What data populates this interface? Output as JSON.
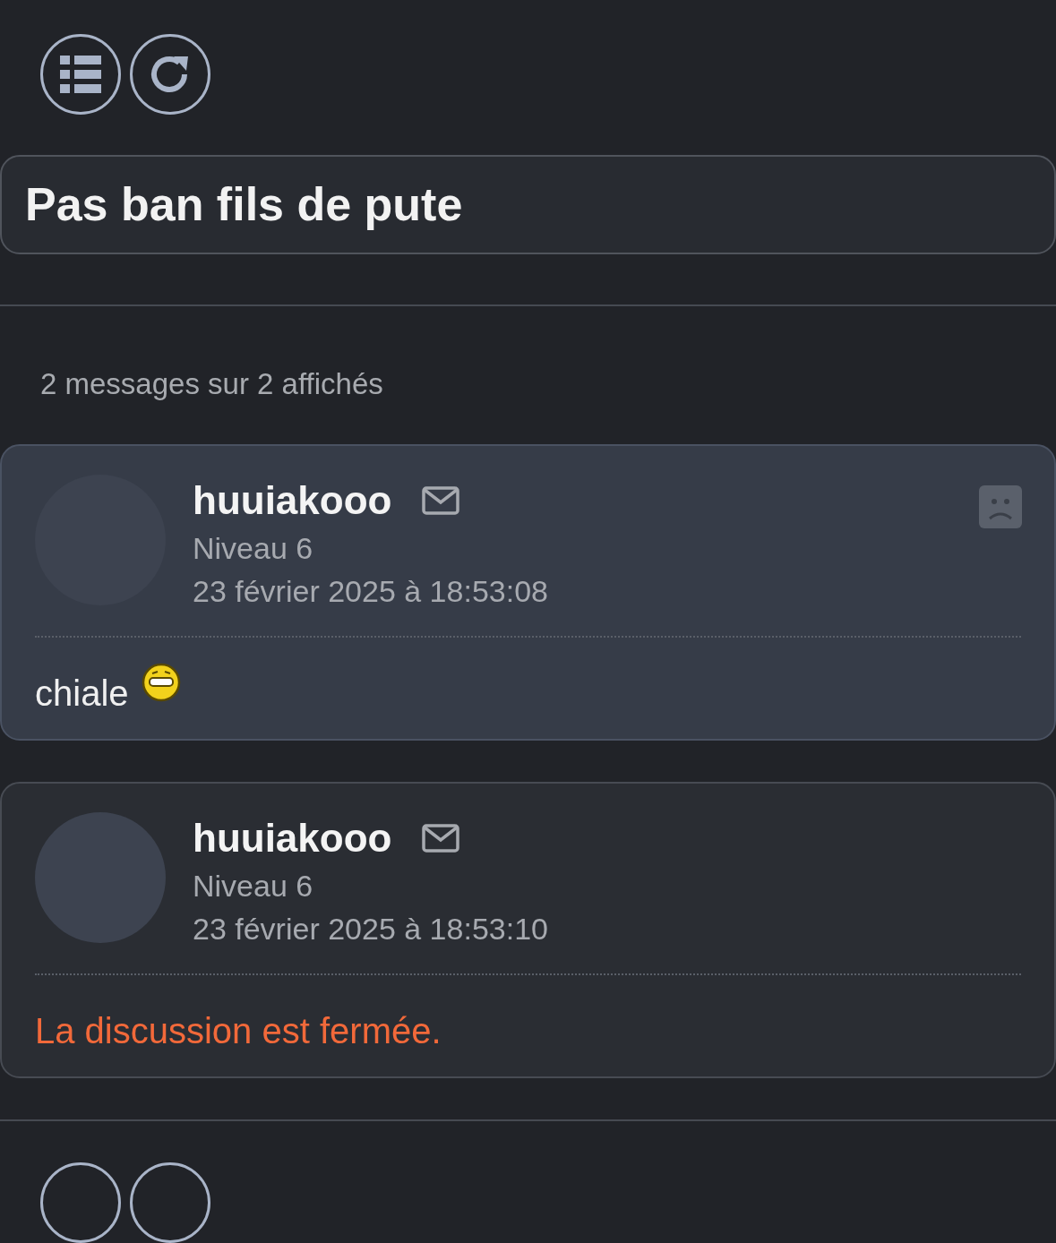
{
  "title": "Pas ban fils de pute",
  "message_count": "2 messages sur 2 affichés",
  "posts": [
    {
      "author": "huuiakooo",
      "level": "Niveau 6",
      "date": "23 février 2025 à 18:53:08",
      "highlighted": true,
      "report_icon": true,
      "body": {
        "kind": "message",
        "text": "chiale",
        "emoji": true
      }
    },
    {
      "author": "huuiakooo",
      "level": "Niveau 6",
      "date": "23 février 2025 à 18:53:10",
      "highlighted": false,
      "report_icon": false,
      "body": {
        "kind": "notice",
        "text": "La discussion est fermée.",
        "emoji": false
      }
    }
  ]
}
